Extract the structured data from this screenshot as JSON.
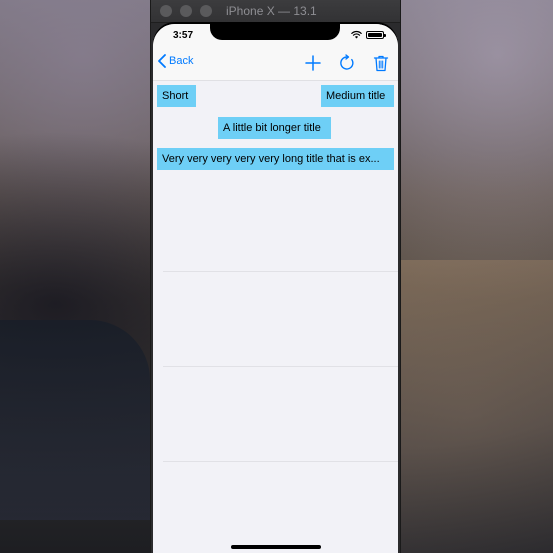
{
  "window": {
    "title": "iPhone X — 13.1"
  },
  "status_bar": {
    "time": "3:57",
    "wifi_icon": "wifi-icon",
    "battery_icon": "battery-icon"
  },
  "nav_bar": {
    "back_label": "Back",
    "actions": [
      {
        "icon": "plus-icon"
      },
      {
        "icon": "refresh-icon"
      },
      {
        "icon": "trash-icon"
      }
    ],
    "tint_color": "#007aff"
  },
  "chips": [
    {
      "title": "Short"
    },
    {
      "title": "Medium title"
    },
    {
      "title": "A little bit longer title"
    },
    {
      "title": "Very very very very very long title that is ex..."
    }
  ],
  "colors": {
    "chip_background": "#6ecff6",
    "screen_background": "#f2f2f7"
  }
}
